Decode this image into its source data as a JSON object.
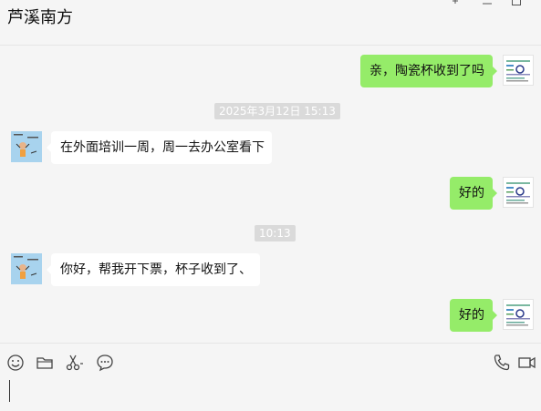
{
  "header": {
    "title": "芦溪南方"
  },
  "window_controls": {
    "pin_icon": "pin-icon",
    "minimize_icon": "minimize-icon",
    "maximize_icon": "maximize-icon"
  },
  "messages": [
    {
      "sender": "self",
      "text": "亲，陶瓷杯收到了吗"
    },
    {
      "type": "time",
      "text": "2025年3月12日 15:13"
    },
    {
      "sender": "other",
      "text": "在外面培训一周，周一去办公室看下"
    },
    {
      "sender": "self",
      "text": "好的"
    },
    {
      "type": "time",
      "text": "10:13"
    },
    {
      "sender": "other",
      "text": "你好，帮我开下票，杯子收到了、"
    },
    {
      "sender": "self",
      "text": "好的"
    }
  ],
  "toolbar": {
    "emoji_icon": "smiley-icon",
    "file_icon": "folder-icon",
    "screenshot_icon": "scissors-icon",
    "chat_history_icon": "speech-bubble-icon",
    "voice_call_icon": "phone-icon",
    "video_call_icon": "video-camera-icon"
  },
  "colors": {
    "self_bubble": "#95ec69",
    "other_bubble": "#ffffff",
    "background": "#f5f5f5",
    "timestamp_bg": "#dadada"
  }
}
